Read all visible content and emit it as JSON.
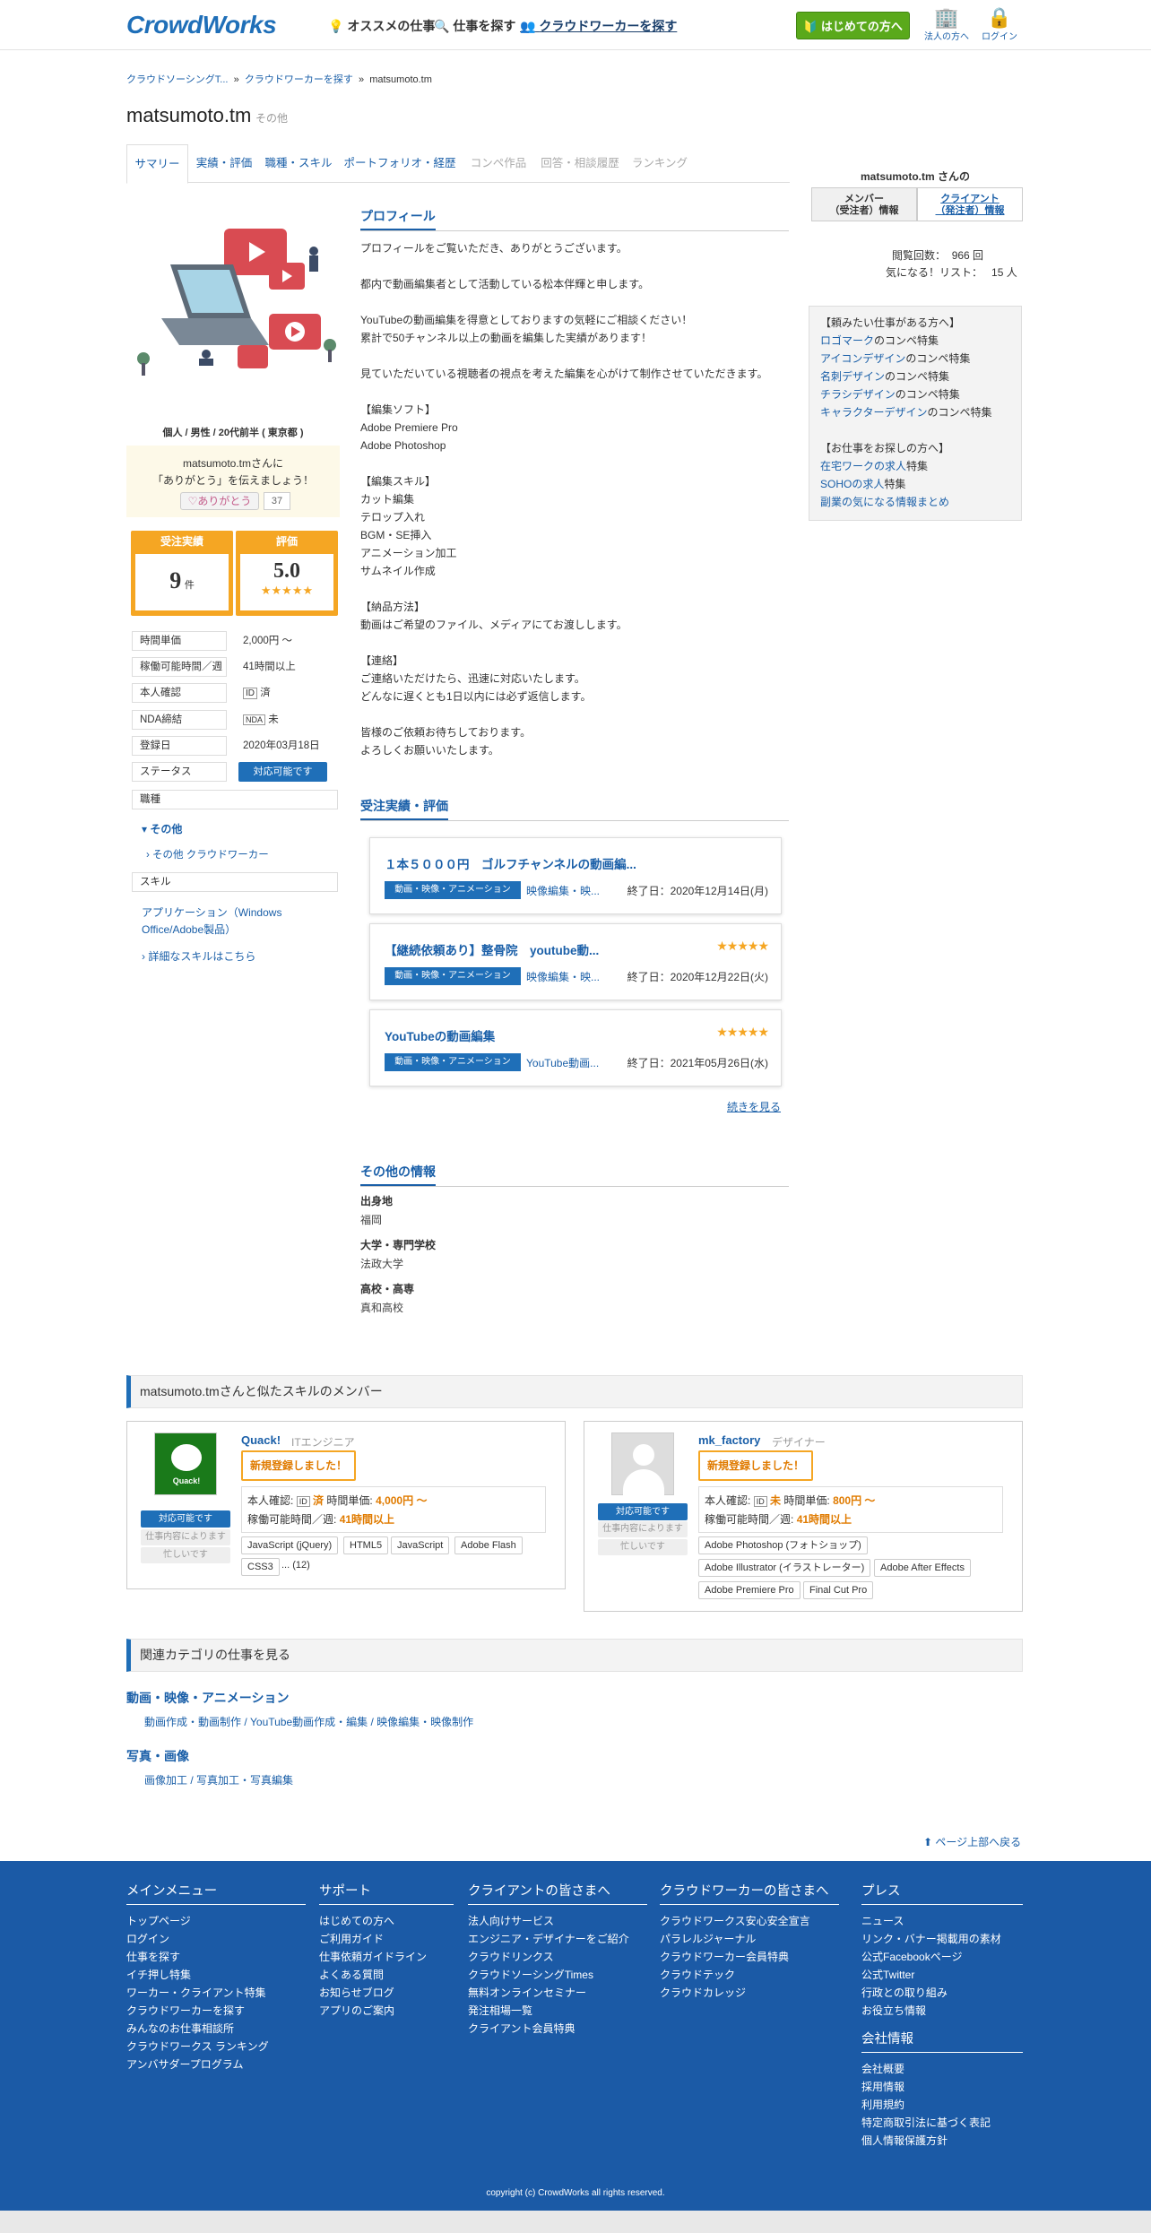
{
  "header": {
    "logo": "CrowdWorks",
    "nav": [
      "オススメの仕事",
      "仕事を探す",
      "クラウドワーカーを探す"
    ],
    "start_button": "はじめての方へ",
    "corp": "法人の方へ",
    "login": "ログイン"
  },
  "breadcrumb": {
    "items": [
      "クラウドソーシングT...",
      "クラウドワーカーを探す",
      "matsumoto.tm"
    ],
    "separator": "»"
  },
  "profile": {
    "username": "matsumoto.tm",
    "category": "その他",
    "demographics": "個人 / 男性 / 20代前半 ( 東京都 )",
    "thanks_line1": "matsumoto.tmさんに",
    "thanks_line2": "「ありがとう」を伝えましょう！",
    "thanks_button": "ありがとう",
    "thanks_count": "37",
    "orders_label": "受注実績",
    "orders_value": "9",
    "orders_unit": "件",
    "rating_label": "評価",
    "rating_value": "5.0",
    "rating_stars": "★★★★★"
  },
  "tabs": [
    "サマリー",
    "実績・評価",
    "職種・スキル",
    "ポートフォリオ・経歴",
    "コンペ作品",
    "回答・相談履歴",
    "ランキング"
  ],
  "specs": [
    {
      "k": "時間単価",
      "v": "2,000円 〜"
    },
    {
      "k": "稼働可能時間／週",
      "v": "41時間以上"
    },
    {
      "k": "本人確認",
      "v": "済"
    },
    {
      "k": "NDA締結",
      "v": "未"
    },
    {
      "k": "登録日",
      "v": "2020年03月18日"
    },
    {
      "k": "ステータス",
      "v": "対応可能です"
    }
  ],
  "left": {
    "job_label": "職種",
    "job_cat": "その他",
    "job_sub": "その他 クラウドワーカー",
    "skill_label": "スキル",
    "skill_line1": "アプリケーション（Windows",
    "skill_line2": "Office/Adobe製品）",
    "skill_more": "詳細なスキルはこちら"
  },
  "sections": {
    "profile": "プロフィール",
    "orders": "受注実績・評価",
    "other": "その他の情報"
  },
  "profile_text": [
    "プロフィールをご覧いただき、ありがとうございます。",
    "",
    "都内で動画編集者として活動している松本伴輝と申します。",
    "",
    "YouTubeの動画編集を得意としておりますの気軽にご相談ください！",
    "累計で50チャンネル以上の動画を編集した実績があります！",
    "",
    "見ていただいている視聴者の視点を考えた編集を心がけて制作させていただきます。",
    "",
    "【編集ソフト】",
    "Adobe Premiere Pro",
    "Adobe Photoshop",
    "",
    "【編集スキル】",
    "カット編集",
    "テロップ入れ",
    "BGM・SE挿入",
    "アニメーション加工",
    "サムネイル作成",
    "",
    "【納品方法】",
    "動画はご希望のファイル、メディアにてお渡しします。",
    "",
    "【連絡】",
    "ご連絡いただけたら、迅速に対応いたします。",
    "どんなに遅くとも1日以内には必ず返信します。",
    "",
    "皆様のご依頼お待ちしております。",
    "よろしくお願いいたします。"
  ],
  "orders": [
    {
      "title": "１本５０００円　ゴルフチャンネルの動画編...",
      "stars": "",
      "cat": "動画・映像・アニメーション",
      "sub": "映像編集・映...",
      "end": "終了日：2020年12月14日(月)"
    },
    {
      "title": "【継続依頼あり】整骨院　youtube動...",
      "stars": "★★★★★",
      "cat": "動画・映像・アニメーション",
      "sub": "映像編集・映...",
      "end": "終了日：2020年12月22日(火)"
    },
    {
      "title": "YouTubeの動画編集",
      "stars": "★★★★★",
      "cat": "動画・映像・アニメーション",
      "sub": "YouTube動画...",
      "end": "終了日：2021年05月26日(水)"
    }
  ],
  "more_link": "続きを見る",
  "other_info": [
    {
      "k": "出身地",
      "v": "福岡"
    },
    {
      "k": "大学・専門学校",
      "v": "法政大学"
    },
    {
      "k": "高校・高専",
      "v": "真和高校"
    }
  ],
  "right": {
    "title": "matsumoto.tm さんの",
    "tab_member": "メンバー",
    "tab_member2": "（受注者）情報",
    "tab_client": "クライアント",
    "tab_client2": "（発注者）情報",
    "views_label": "閲覧回数：",
    "views": "966 回",
    "fav_label": "気になる！リスト：",
    "fav": "15 人",
    "want_head": "【頼みたい仕事がある方へ】",
    "want_links": [
      {
        "a": "ロゴマーク",
        "t": "のコンペ特集"
      },
      {
        "a": "アイコンデザイン",
        "t": "のコンペ特集"
      },
      {
        "a": "名刺デザイン",
        "t": "のコンペ特集"
      },
      {
        "a": "チラシデザイン",
        "t": "のコンペ特集"
      },
      {
        "a": "キャラクターデザイン",
        "t": "のコンペ特集"
      }
    ],
    "seek_head": "【お仕事をお探しの方へ】",
    "seek_links": [
      {
        "a": "在宅ワークの求人",
        "t": "特集"
      },
      {
        "a": "SOHOの求人",
        "t": "特集"
      },
      {
        "a": "副業の気になる情報まとめ",
        "t": ""
      }
    ]
  },
  "similar": {
    "heading": "matsumoto.tmさんと似たスキルのメンバー",
    "members": [
      {
        "name": "Quack!",
        "role": "ITエンジニア",
        "badge": "新規登録しました！",
        "avail": "対応可能です",
        "g1": "仕事内容によります",
        "g2": "忙しいです",
        "id_label": "本人確認:",
        "id": "済",
        "rate_label": "時間単価:",
        "rate": "4,000円 〜",
        "hours_label": "稼働可能時間／週:",
        "hours": "41時間以上",
        "skills": [
          "JavaScript (jQuery)",
          "HTML5",
          "JavaScript",
          "Adobe Flash",
          "CSS3"
        ],
        "more": "... (12)"
      },
      {
        "name": "mk_factory",
        "role": "デザイナー",
        "badge": "新規登録しました！",
        "avail": "対応可能です",
        "g1": "仕事内容によります",
        "g2": "忙しいです",
        "id_label": "本人確認:",
        "id": "未",
        "rate_label": "時間単価:",
        "rate": "800円 〜",
        "hours_label": "稼働可能時間／週:",
        "hours": "41時間以上",
        "skills": [
          "Adobe Photoshop (フォトショップ)",
          "Adobe Illustrator (イラストレーター)",
          "Adobe After Effects",
          "Adobe Premiere Pro",
          "Final Cut Pro"
        ]
      }
    ]
  },
  "related": {
    "heading": "関連カテゴリの仕事を見る",
    "cat1": "動画・映像・アニメーション",
    "cat1_links": "動画作成・動画制作 / YouTube動画作成・編集 / 映像編集・映像制作",
    "cat2": "写真・画像",
    "cat2_links": "画像加工 / 写真加工・写真編集"
  },
  "back_top": "ページ上部へ戻る",
  "footer": {
    "cols": [
      {
        "h": "メインメニュー",
        "items": [
          "トップページ",
          "ログイン",
          "仕事を探す",
          "イチ押し特集",
          "ワーカー・クライアント特集",
          "クラウドワーカーを探す",
          "みんなのお仕事相談所",
          "クラウドワークス ランキング",
          "アンバサダープログラム"
        ]
      },
      {
        "h": "サポート",
        "items": [
          "はじめての方へ",
          "ご利用ガイド",
          "仕事依頼ガイドライン",
          "よくある質問",
          "お知らせブログ",
          "アプリのご案内"
        ]
      },
      {
        "h": "クライアントの皆さまへ",
        "items": [
          "法人向けサービス",
          "エンジニア・デザイナーをご紹介",
          "クラウドリンクス",
          "クラウドソーシングTimes",
          "無料オンラインセミナー",
          "発注相場一覧",
          "クライアント会員特典"
        ]
      },
      {
        "h": "クラウドワーカーの皆さまへ",
        "items": [
          "クラウドワークス安心安全宣言",
          "パラレルジャーナル",
          "クラウドワーカー会員特典",
          "クラウドテック",
          "クラウドカレッジ"
        ]
      },
      {
        "h": "プレス",
        "items": [
          "ニュース",
          "リンク・バナー掲載用の素材",
          "公式Facebookページ",
          "公式Twitter",
          "行政との取り組み",
          "お役立ち情報"
        ]
      },
      {
        "h": "会社情報",
        "items": [
          "会社概要",
          "採用情報",
          "利用規約",
          "特定商取引法に基づく表記",
          "個人情報保護方針"
        ]
      }
    ],
    "copyright": "copyright (c) CrowdWorks all rights reserved."
  }
}
